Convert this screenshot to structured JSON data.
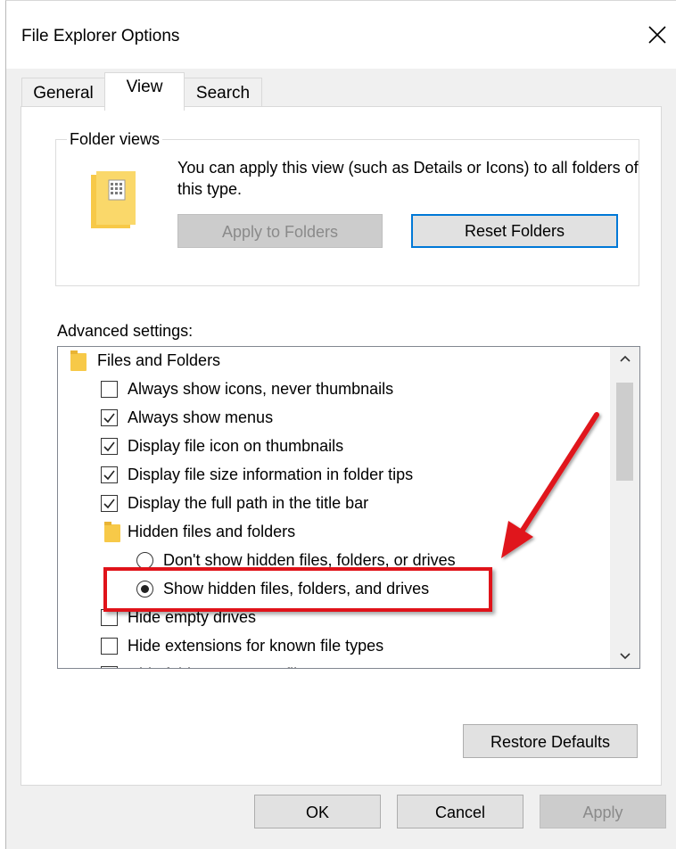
{
  "window": {
    "title": "File Explorer Options",
    "close_glyph": "✕"
  },
  "tabs": [
    {
      "label": "General"
    },
    {
      "label": "View"
    },
    {
      "label": "Search"
    }
  ],
  "folder_views": {
    "group_label": "Folder views",
    "description": "You can apply this view (such as Details or Icons) to all folders of this type.",
    "apply_button": "Apply to Folders",
    "reset_button": "Reset Folders"
  },
  "advanced": {
    "label": "Advanced settings:",
    "items": [
      {
        "type": "folder",
        "label": "Files and Folders"
      },
      {
        "type": "checkbox",
        "label": "Always show icons, never thumbnails",
        "checked": false
      },
      {
        "type": "checkbox",
        "label": "Always show menus",
        "checked": true
      },
      {
        "type": "checkbox",
        "label": "Display file icon on thumbnails",
        "checked": true
      },
      {
        "type": "checkbox",
        "label": "Display file size information in folder tips",
        "checked": true
      },
      {
        "type": "checkbox",
        "label": "Display the full path in the title bar",
        "checked": true
      },
      {
        "type": "folder",
        "label": "Hidden files and folders"
      },
      {
        "type": "radio",
        "label": "Don't show hidden files, folders, or drives",
        "checked": false
      },
      {
        "type": "radio",
        "label": "Show hidden files, folders, and drives",
        "checked": true
      },
      {
        "type": "checkbox",
        "label": "Hide empty drives",
        "checked": false
      },
      {
        "type": "checkbox",
        "label": "Hide extensions for known file types",
        "checked": false
      },
      {
        "type": "checkbox",
        "label": "Hide folder merge conflicts",
        "checked": false
      }
    ],
    "scroll_up_glyph": "▲",
    "scroll_down_glyph": "▼"
  },
  "restore_defaults": "Restore Defaults",
  "footer": {
    "ok": "OK",
    "cancel": "Cancel",
    "apply": "Apply"
  },
  "colors": {
    "annotation": "#e0131a",
    "focus": "#0078d7",
    "folder": "#f7c948"
  }
}
